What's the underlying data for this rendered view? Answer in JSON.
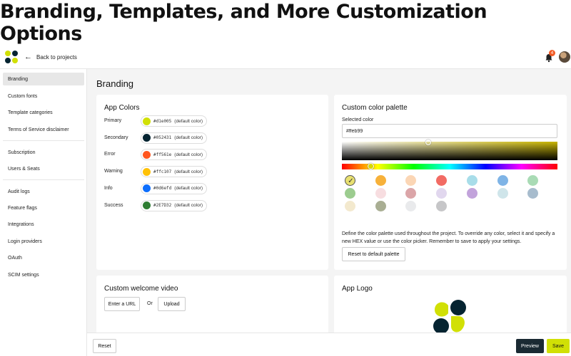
{
  "banner": {
    "title": "Branding, Templates, and More Customization Options"
  },
  "topbar": {
    "back_label": "Back to projects",
    "notification_count": "4"
  },
  "sidebar": {
    "items": [
      {
        "label": "Branding",
        "active": true
      },
      {
        "label": "Custom fonts"
      },
      {
        "label": "Template categories"
      },
      {
        "label": "Terms of Service disclaimer"
      },
      {
        "label": "Subscription"
      },
      {
        "label": "Users & Seats"
      },
      {
        "label": "Audit logs"
      },
      {
        "label": "Feature flags"
      },
      {
        "label": "Integrations"
      },
      {
        "label": "Login providers"
      },
      {
        "label": "OAuth"
      },
      {
        "label": "SCIM settings"
      }
    ]
  },
  "main": {
    "title": "Branding",
    "app_colors": {
      "title": "App Colors",
      "default_suffix": "(default color)",
      "rows": [
        {
          "label": "Primary",
          "hex": "#d1e005",
          "color": "#d1e005"
        },
        {
          "label": "Secondary",
          "hex": "#052431",
          "color": "#052431"
        },
        {
          "label": "Error",
          "hex": "#ff561e",
          "color": "#ff561e"
        },
        {
          "label": "Warning",
          "hex": "#ffc107",
          "color": "#ffc107"
        },
        {
          "label": "Info",
          "hex": "#0d6efd",
          "color": "#0d6efd"
        },
        {
          "label": "Success",
          "hex": "#2E7D32",
          "color": "#2E7D32"
        }
      ]
    },
    "palette": {
      "title": "Custom color palette",
      "selected_label": "Selected color",
      "selected_value": "#ffeb99",
      "swatches": [
        "#e8e070",
        "#f7b13a",
        "#fbd6b5",
        "#f26b64",
        "#a8dde9",
        "#7fb4e6",
        "#a9dbb5",
        "#9ccc8f",
        "#f7dde0",
        "#dba5a8",
        "#e1d7ee",
        "#c2a3db",
        "#cfe5ea",
        "#a7bccd",
        "#f3e9ce",
        "#a9ae93",
        "#e9eaec",
        "#c6c6c8"
      ],
      "selected_index": 0,
      "description": "Define the color palette used throughout the project. To override any color, select it and specify a new HEX value or use the color picker. Remember to save to apply your settings.",
      "reset_label": "Reset to default palette"
    },
    "welcome_video": {
      "title": "Custom welcome video",
      "url_label": "Enter a URL",
      "or_label": "Or",
      "upload_label": "Upload"
    },
    "app_logo": {
      "title": "App Logo"
    }
  },
  "footer": {
    "reset_label": "Reset",
    "preview_label": "Preview",
    "save_label": "Save"
  }
}
